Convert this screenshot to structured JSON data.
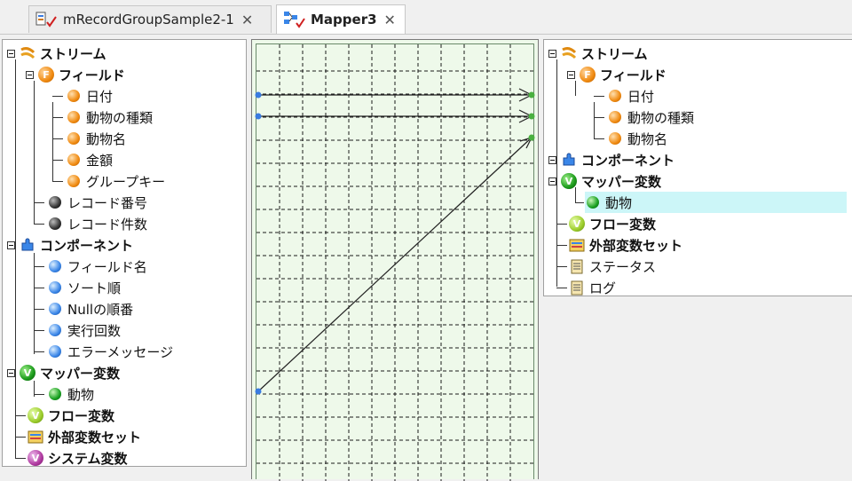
{
  "tabs": [
    {
      "label": "mRecordGroupSample2-1",
      "close": "✕",
      "active": false
    },
    {
      "label": "Mapper3",
      "close": "✕",
      "active": true
    }
  ],
  "left_tree": {
    "stream": "ストリーム",
    "field": "フィールド",
    "fields": [
      "日付",
      "動物の種類",
      "動物名",
      "金額",
      "グループキー"
    ],
    "record_no": "レコード番号",
    "record_count": "レコード件数",
    "component": "コンポーネント",
    "component_items": [
      "フィールド名",
      "ソート順",
      "Nullの順番",
      "実行回数",
      "エラーメッセージ"
    ],
    "mapper_var": "マッパー変数",
    "mapper_var_item": "動物",
    "flow_var": "フロー変数",
    "ext_var_set": "外部変数セット",
    "system_var": "システム変数"
  },
  "right_tree": {
    "stream": "ストリーム",
    "field": "フィールド",
    "fields": [
      "日付",
      "動物の種類",
      "動物名"
    ],
    "component": "コンポーネント",
    "mapper_var": "マッパー変数",
    "mapper_var_item": "動物",
    "flow_var": "フロー変数",
    "ext_var_set": "外部変数セット",
    "status": "ステータス",
    "log": "ログ"
  },
  "icons": {
    "tab1": "record-group-icon",
    "tab2": "mapper-icon",
    "stream": "stream-icon",
    "field": "field-folder-icon",
    "field_item": "orange-ball-icon",
    "record_item": "black-ball-icon",
    "component": "puzzle-icon",
    "component_item": "blue-ball-icon",
    "mapper_var": "green-variable-icon",
    "flow_var": "lime-variable-icon",
    "ext_var_set": "variable-set-icon",
    "system_var": "purple-variable-icon",
    "status": "document-icon",
    "log": "document-icon"
  },
  "colors": {
    "mapper_bg": "#eef9ea",
    "selection": "#ccf6f8",
    "grid_line": "#1a1a1a"
  }
}
